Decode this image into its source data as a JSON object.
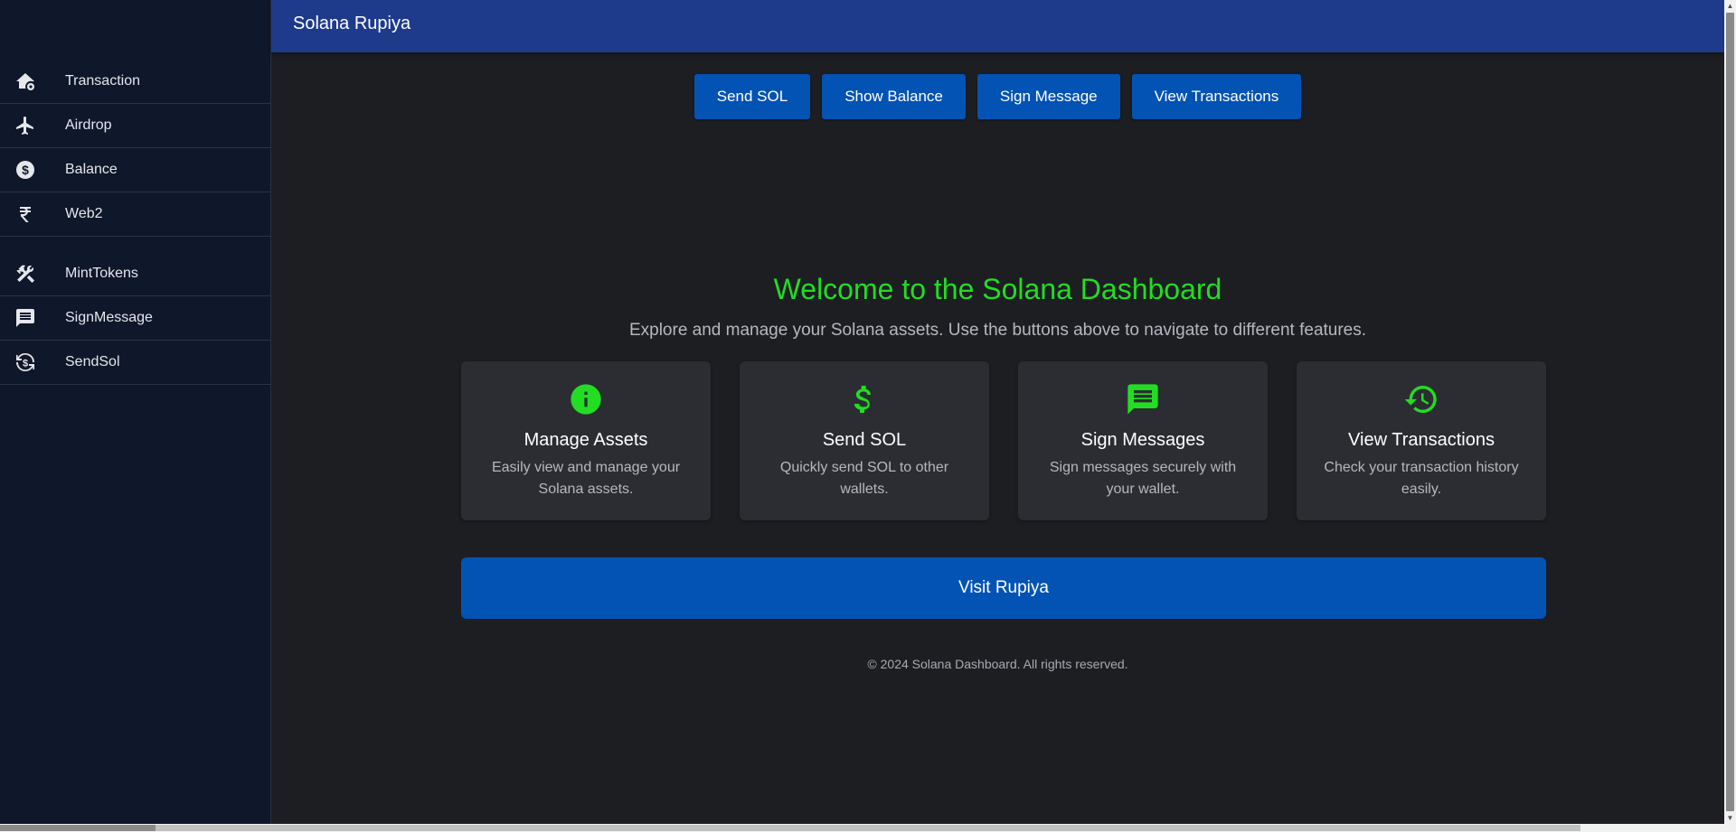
{
  "header": {
    "title": "Solana Rupiya"
  },
  "sidebar": {
    "group_primary": [
      {
        "label": "Transaction",
        "icon": "home-gear-icon"
      },
      {
        "label": "Airdrop",
        "icon": "airplane-icon"
      },
      {
        "label": "Balance",
        "icon": "dollar-circle-icon"
      },
      {
        "label": "Web2",
        "icon": "rupee-icon"
      }
    ],
    "group_secondary": [
      {
        "label": "MintTokens",
        "icon": "tools-icon"
      },
      {
        "label": "SignMessage",
        "icon": "message-icon"
      },
      {
        "label": "SendSol",
        "icon": "currency-exchange-icon"
      }
    ]
  },
  "toolbar": {
    "send_sol": "Send SOL",
    "show_balance": "Show Balance",
    "sign_message": "Sign Message",
    "view_transactions": "View Transactions"
  },
  "hero": {
    "title": "Welcome to the Solana Dashboard",
    "subtitle": "Explore and manage your Solana assets. Use the buttons above to navigate to different features."
  },
  "features": [
    {
      "title": "Manage Assets",
      "description": "Easily view and manage your Solana assets.",
      "icon": "info-icon"
    },
    {
      "title": "Send SOL",
      "description": "Quickly send SOL to other wallets.",
      "icon": "dollar-icon"
    },
    {
      "title": "Sign Messages",
      "description": "Sign messages securely with your wallet.",
      "icon": "message-icon"
    },
    {
      "title": "View Transactions",
      "description": "Check your transaction history easily.",
      "icon": "history-icon"
    }
  ],
  "cta": {
    "label": "Visit Rupiya"
  },
  "footer": {
    "text": "© 2024 Solana Dashboard. All rights reserved."
  },
  "colors": {
    "accent": "#22dd22",
    "primary_button": "#0353b5",
    "header": "#1e3a8a",
    "sidebar": "#0f172a",
    "background": "#1c1e22",
    "card": "#2b2d32"
  }
}
